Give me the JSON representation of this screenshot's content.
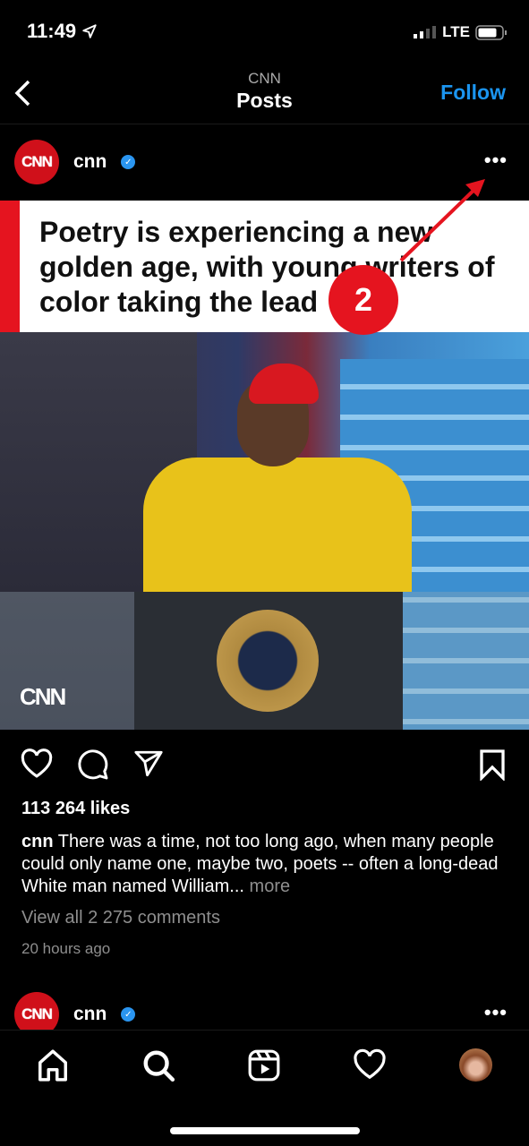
{
  "status_bar": {
    "time": "11:49",
    "network": "LTE"
  },
  "nav": {
    "subtitle": "CNN",
    "title": "Posts",
    "follow_label": "Follow"
  },
  "post": {
    "username": "cnn",
    "avatar_text": "CNN",
    "headline": "Poetry is experiencing a new golden age, with young writers of color taking the lead",
    "watermark": "CNN",
    "likes": "113 264 likes",
    "caption_user": "cnn",
    "caption_text": "There was a time, not too long ago, when many people could only name one, maybe two, poets -- often a long-dead White man named William...",
    "more_label": "more",
    "view_comments": "View all 2 275 comments",
    "time_ago": "20 hours ago"
  },
  "next_post": {
    "username": "cnn",
    "avatar_text": "CNN"
  },
  "annotation": {
    "step": "2",
    "color": "#e5141f"
  },
  "colors": {
    "accent": "#1b95f0",
    "verified": "#2a95f0",
    "cnn_red": "#d0101a"
  },
  "tabbar": {
    "items": [
      "home-icon",
      "search-icon",
      "reels-icon",
      "activity-heart-icon",
      "profile-avatar"
    ]
  }
}
